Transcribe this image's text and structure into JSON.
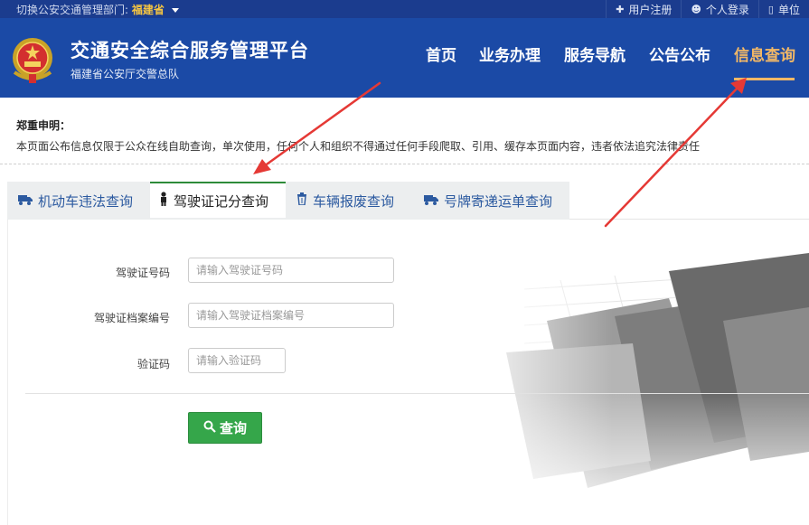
{
  "topbar": {
    "dept_label": "切换公安交通管理部门:",
    "province": "福建省",
    "links": [
      {
        "icon": "plus-icon",
        "label": "用户注册"
      },
      {
        "icon": "user-icon",
        "label": "个人登录"
      },
      {
        "icon": "building-icon",
        "label": "单位"
      }
    ]
  },
  "header": {
    "title": "交通安全综合服务管理平台",
    "subtitle": "福建省公安厅交警总队",
    "nav": [
      "首页",
      "业务办理",
      "服务导航",
      "公告公布",
      "信息查询"
    ],
    "active_nav": "信息查询"
  },
  "notice": {
    "title": "郑重申明：",
    "body": "本页面公布信息仅限于公众在线自助查询，单次使用，任何个人和组织不得通过任何手段爬取、引用、缓存本页面内容，违者依法追究法律责任"
  },
  "tabs": [
    {
      "icon": "truck-icon",
      "label": "机动车违法查询"
    },
    {
      "icon": "person-icon",
      "label": "驾驶证记分查询"
    },
    {
      "icon": "trash-icon",
      "label": "车辆报废查询"
    },
    {
      "icon": "truck-icon",
      "label": "号牌寄递运单查询"
    }
  ],
  "active_tab": "驾驶证记分查询",
  "form": {
    "license_no_label": "驾驶证号码",
    "license_no_placeholder": "请输入驾驶证号码",
    "file_no_label": "驾驶证档案编号",
    "file_no_placeholder": "请输入驾驶证档案编号",
    "captcha_label": "验证码",
    "captcha_placeholder": "请输入验证码",
    "submit_label": "查询"
  },
  "colors": {
    "header_bg": "#1b4aa6",
    "topbar_bg": "#1b3c8e",
    "active_nav": "#f2b866",
    "button_green": "#35a64a",
    "arrow_red": "#e53935"
  }
}
